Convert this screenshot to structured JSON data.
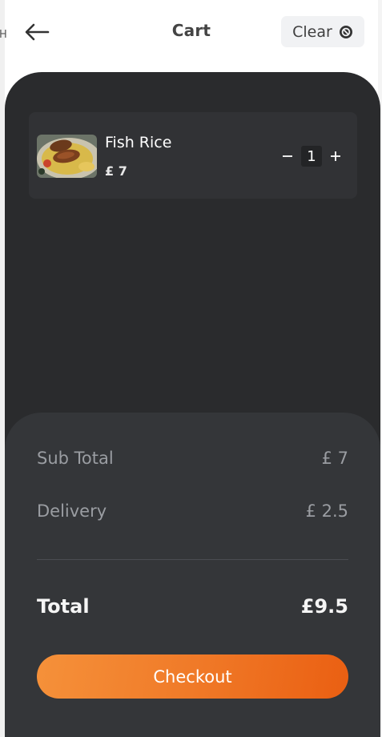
{
  "header": {
    "title": "Cart",
    "clear_label": "Clear",
    "back_icon": "arrow-left-icon",
    "clear_icon": "ban-circle-icon"
  },
  "edge_text": "H",
  "cart": {
    "items": [
      {
        "name": "Fish Rice",
        "price": "£ 7",
        "quantity": "1",
        "image": "fish-rice-thumbnail"
      }
    ]
  },
  "summary": {
    "subtotal_label": "Sub Total",
    "subtotal_value": "£ 7",
    "delivery_label": "Delivery",
    "delivery_value": "£ 2.5",
    "total_label": "Total",
    "total_value": "£9.5",
    "checkout_label": "Checkout"
  },
  "colors": {
    "panel_bg": "#2a2b2d",
    "summary_bg": "#343639",
    "accent": "#f07a28"
  }
}
